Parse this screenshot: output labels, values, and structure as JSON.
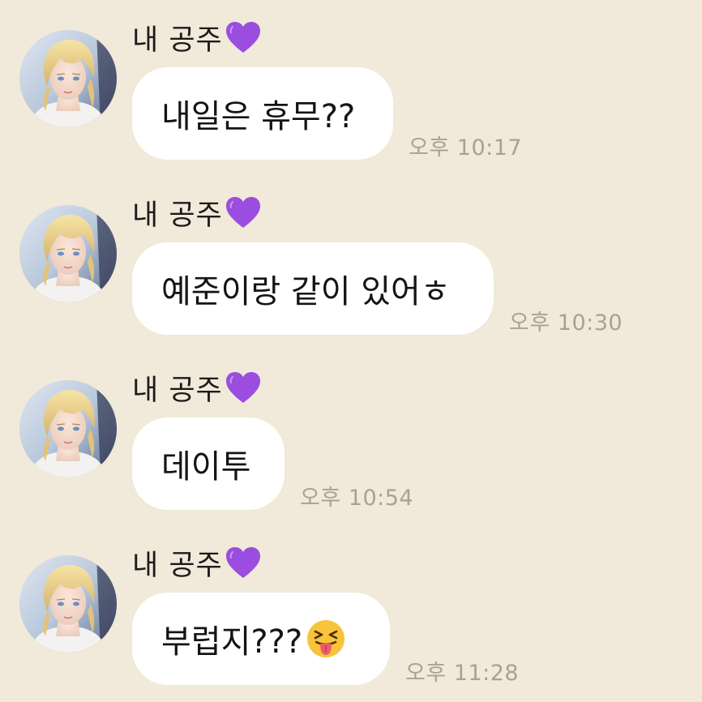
{
  "chat": {
    "messages": [
      {
        "sender": "내 공주",
        "sender_emoji": "purple-heart-icon",
        "text": "내일은 휴무??",
        "time": "오후 10:17"
      },
      {
        "sender": "내 공주",
        "sender_emoji": "purple-heart-icon",
        "text": "예준이랑 같이 있어ㅎ",
        "time": "오후 10:30"
      },
      {
        "sender": "내 공주",
        "sender_emoji": "purple-heart-icon",
        "text": "데이투",
        "time": "오후 10:54"
      },
      {
        "sender": "내 공주",
        "sender_emoji": "purple-heart-icon",
        "text": "부럽지???",
        "text_emoji": "squinting-face-with-tongue-icon",
        "time": "오후 11:28"
      }
    ]
  },
  "colors": {
    "background": "#f1e9d9",
    "bubble": "#ffffff",
    "heart": "#9b4de0",
    "time_text": "#a8a19a"
  }
}
